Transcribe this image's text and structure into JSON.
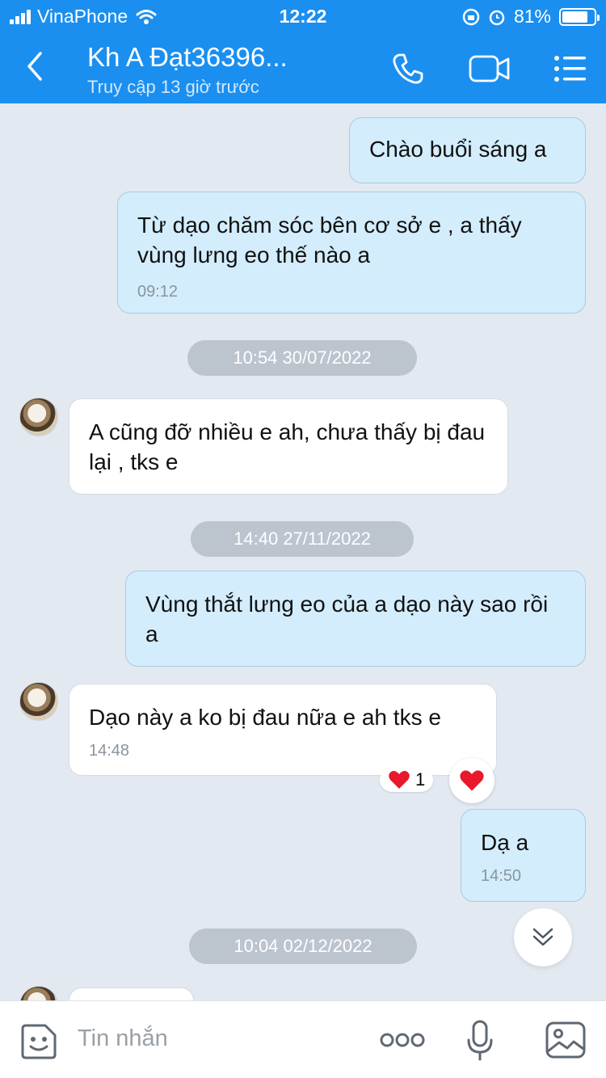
{
  "status_bar": {
    "carrier": "VinaPhone",
    "time": "12:22",
    "battery": "81%",
    "battery_level": 0.81
  },
  "header": {
    "title": "Kh A Đạt36396...",
    "subtitle": "Truy cập 13 giờ trước"
  },
  "messages": [
    {
      "text": "Chào buổi sáng a"
    },
    {
      "text": "Từ dạo chăm sóc bên cơ sở e , a thấy vùng lưng eo thế nào a",
      "time": "09:12"
    },
    {
      "text": "A cũng đỡ nhiều e ah, chưa thấy bị đau lại , tks e"
    },
    {
      "text": "Vùng thắt lưng eo của a dạo này sao rồi a"
    },
    {
      "text": "Dạo này a ko bị đau nữa e ah tks e",
      "time": "14:48",
      "reaction_count": "1"
    },
    {
      "text": "Dạ a",
      "time": "14:50"
    }
  ],
  "dates": [
    "10:54 30/07/2022",
    "14:40 27/11/2022",
    "10:04 02/12/2022"
  ],
  "composer": {
    "placeholder": "Tin nhắn"
  },
  "colors": {
    "header": "#1a8ff0",
    "background": "#e2e9f1",
    "mine_bubble": "#d3edfc",
    "reaction": "#e8192c"
  }
}
